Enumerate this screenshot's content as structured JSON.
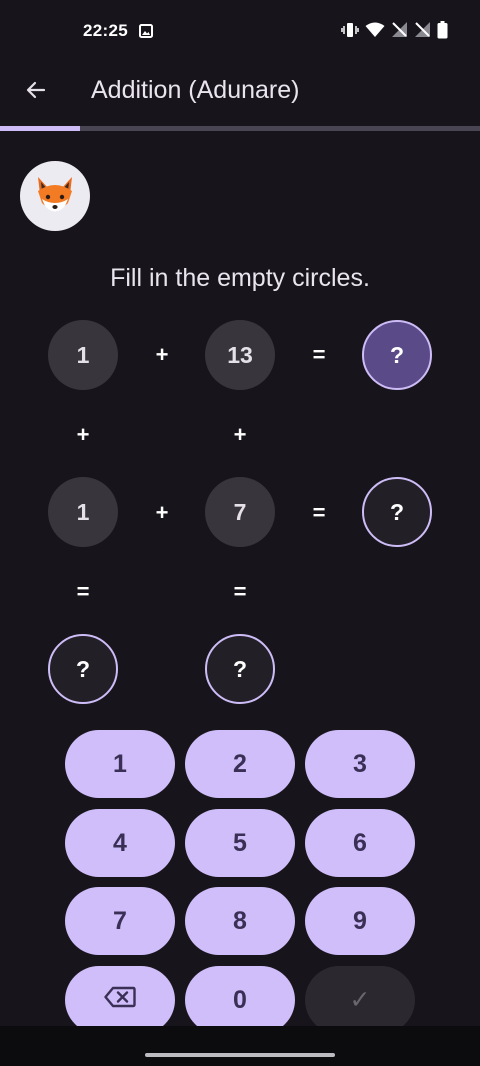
{
  "status_bar": {
    "time": "22:25",
    "icons": [
      "image-icon",
      "vibrate-icon",
      "wifi-icon",
      "no-signal-icon",
      "no-signal-icon",
      "battery-icon"
    ]
  },
  "header": {
    "title": "Addition (Adunare)",
    "back_icon": "arrow-left-icon"
  },
  "progress": {
    "fraction": 0.167
  },
  "avatar": {
    "emoji": "🦊"
  },
  "instruction": "Fill in the empty circles.",
  "puzzle": {
    "row1": {
      "a": "1",
      "op": "+",
      "b": "13",
      "eq": "=",
      "result": "?"
    },
    "vertical_ops": {
      "left": "+",
      "right": "+"
    },
    "row2": {
      "a": "1",
      "op": "+",
      "b": "7",
      "eq": "=",
      "result": "?"
    },
    "vertical_eqs": {
      "left": "=",
      "right": "="
    },
    "column_results": {
      "left": "?",
      "right": "?"
    },
    "selected_cell": "row1.result"
  },
  "keypad": {
    "keys": [
      "1",
      "2",
      "3",
      "4",
      "5",
      "6",
      "7",
      "8",
      "9",
      "backspace",
      "0",
      "✓"
    ],
    "backspace_icon": "backspace-icon",
    "check_enabled": false
  },
  "colors": {
    "background": "#17151b",
    "accent": "#cdbcf6",
    "key_fill": "#d0befa",
    "given_cell": "#38353d",
    "selected_cell": "#5a4a88"
  }
}
